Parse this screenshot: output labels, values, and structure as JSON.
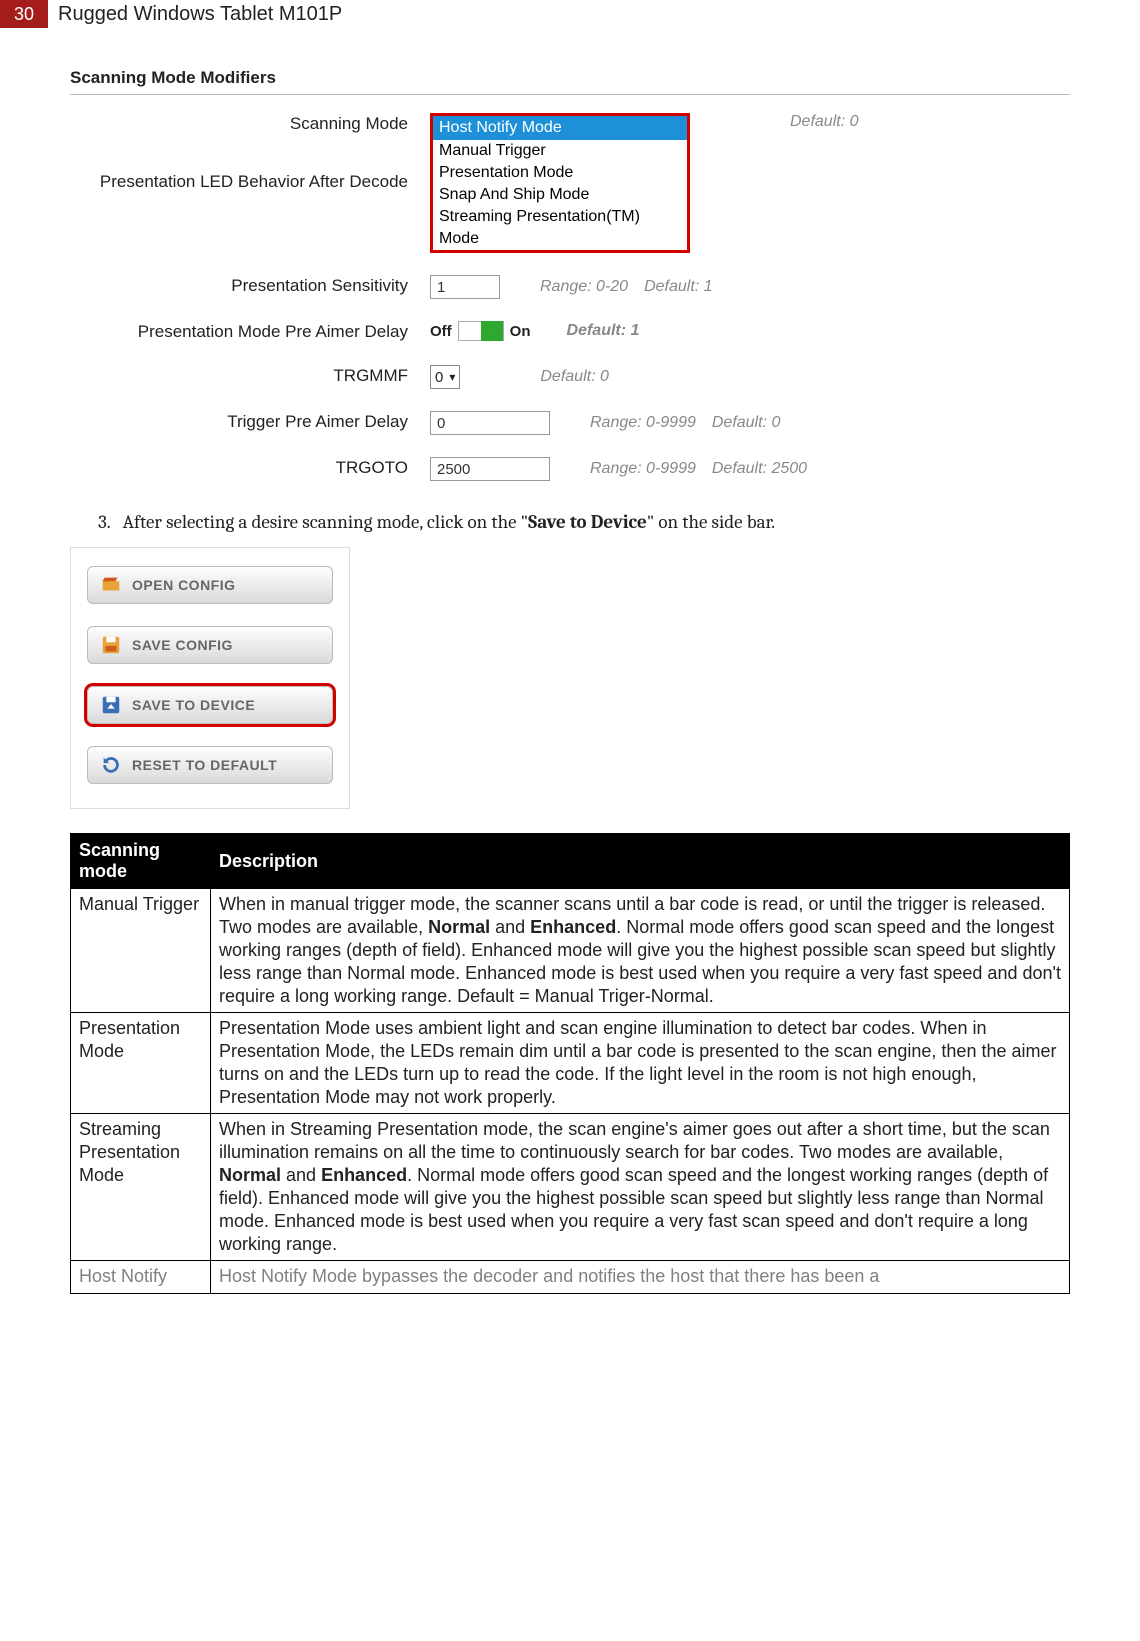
{
  "header": {
    "page_number": "30",
    "doc_title": "Rugged Windows Tablet M101P"
  },
  "panel": {
    "title": "Scanning Mode Modifiers",
    "scanning_mode": {
      "label": "Scanning Mode",
      "selected": "Host Notify Mode",
      "options": [
        "Manual Trigger",
        "Presentation Mode",
        "Snap And Ship Mode",
        "Streaming Presentation(TM) Mode"
      ],
      "default_text": "Default: 0"
    },
    "led_behavior": {
      "label": "Presentation LED Behavior After Decode"
    },
    "sensitivity": {
      "label": "Presentation Sensitivity",
      "value": "1",
      "range": "Range: 0-20",
      "default": "Default: 1"
    },
    "aimer_delay": {
      "label": "Presentation Mode Pre Aimer Delay",
      "off": "Off",
      "on": "On",
      "default": "Default: 1"
    },
    "trgmmf": {
      "label": "TRGMMF",
      "value": "0",
      "default": "Default: 0"
    },
    "trg_pre_aimer": {
      "label": "Trigger Pre Aimer Delay",
      "value": "0",
      "range": "Range: 0-9999",
      "default": "Default: 0"
    },
    "trgoto": {
      "label": "TRGOTO",
      "value": "2500",
      "range": "Range: 0-9999",
      "default": "Default: 2500"
    }
  },
  "instruction": {
    "num": "3.",
    "before": "After selecting a desire scanning mode, click on the \"",
    "bold": "Save to Device",
    "after": "\" on the side bar."
  },
  "sidebar": {
    "open": "OPEN CONFIG",
    "save": "SAVE CONFIG",
    "device": "SAVE TO DEVICE",
    "reset": "RESET TO DEFAULT"
  },
  "table": {
    "head_mode": "Scanning mode",
    "head_desc": "Description",
    "rows": [
      {
        "mode": "Manual Trigger",
        "desc_before": "When in manual trigger mode, the scanner scans until a bar code is read, or until the trigger is released. Two modes are available, ",
        "bold1": "Normal",
        "mid": " and ",
        "bold2": "Enhanced",
        "desc_after": ". Normal mode offers good scan speed and the longest working ranges (depth of field). Enhanced mode will give you the highest possible scan speed but slightly less range than Normal mode. Enhanced mode is best used when you require a very fast speed and don't require a long working range. Default = Manual Triger-Normal."
      },
      {
        "mode": "Presentation Mode",
        "desc": "Presentation Mode uses ambient light and scan engine illumination to detect bar codes. When in Presentation Mode, the LEDs remain dim until a bar code is presented to the scan engine, then the aimer turns on and the LEDs turn up to read the code. If the light level in the room is not high enough, Presentation Mode may not work properly."
      },
      {
        "mode": "Streaming Presentation Mode",
        "desc_before": "When in Streaming Presentation mode, the scan engine's aimer goes out after a short time, but the scan illumination remains on all the time to continuously search for bar codes. Two modes are available, ",
        "bold1": "Normal",
        "mid": " and ",
        "bold2": "Enhanced",
        "desc_after": ". Normal mode offers good scan speed and the longest working ranges (depth of field). Enhanced mode will give you the highest possible scan speed but slightly less range than Normal mode. Enhanced mode is best used when you require a very fast scan speed and don't require a long working range."
      },
      {
        "mode": "Host Notify",
        "desc": "Host Notify Mode bypasses the decoder and notifies the host that there has been a"
      }
    ]
  }
}
